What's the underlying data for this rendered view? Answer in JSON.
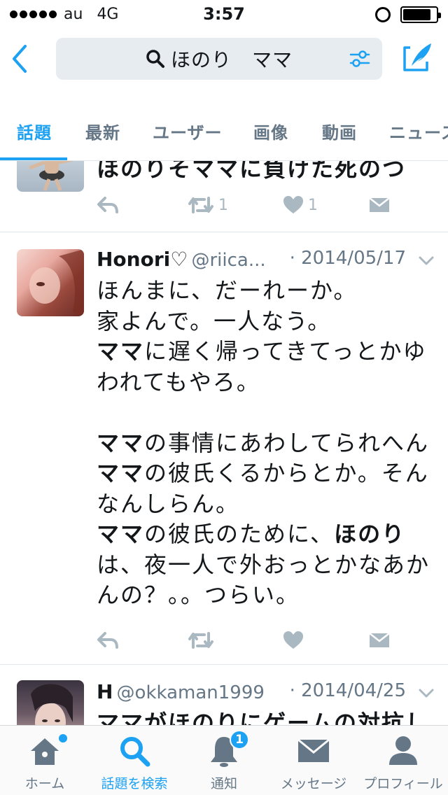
{
  "status_bar": {
    "carrier": "au",
    "network": "4G",
    "time": "3:57",
    "battery_level": 0.85
  },
  "search": {
    "query": "ほのり　ママ"
  },
  "tabs": [
    {
      "label": "話題",
      "active": true
    },
    {
      "label": "最新",
      "active": false
    },
    {
      "label": "ユーザー",
      "active": false
    },
    {
      "label": "画像",
      "active": false
    },
    {
      "label": "動画",
      "active": false
    },
    {
      "label": "ニュース",
      "active": false
    }
  ],
  "tweets": [
    {
      "text_partial": "ほのりそママに負けた死のつ",
      "retweet_count": "1",
      "like_count": "1"
    },
    {
      "name": "Honori♡",
      "handle": "@riica...",
      "date": "· 2014/05/17",
      "lines": [
        "ほんまに、だーれーか。",
        "家よんで。一人なう。",
        "ママに遅く帰ってきてっとかゆ",
        "われてもやろ。",
        "",
        "ママの事情にあわしてられへん",
        "ママの彼氏くるからとか。そん",
        "なんしらん。",
        "ママの彼氏のために、ほのり",
        "は、夜一人で外おっとかなあか",
        "んの？。。つらい。"
      ],
      "retweet_count": "",
      "like_count": ""
    },
    {
      "name": "H",
      "handle": "@okkaman1999",
      "date": "· 2014/04/25",
      "text_partial": "ママがほのりにゲームの対抗し"
    }
  ],
  "bottom_tabs": [
    {
      "label": "ホーム",
      "icon": "home-icon"
    },
    {
      "label": "話題を検索",
      "icon": "search-icon",
      "active": true
    },
    {
      "label": "通知",
      "icon": "bell-icon",
      "badge": "1"
    },
    {
      "label": "メッセージ",
      "icon": "envelope-icon"
    },
    {
      "label": "プロフィール",
      "icon": "person-icon"
    }
  ],
  "colors": {
    "accent": "#1da1f2",
    "muted": "#657786",
    "icon_gray": "#aab8c2"
  }
}
